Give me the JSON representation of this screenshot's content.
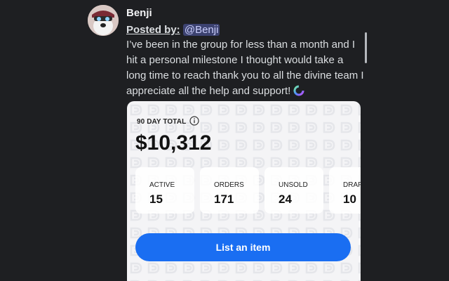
{
  "post": {
    "username": "Benji",
    "posted_by_label": "Posted by:",
    "mention": "@Benji",
    "message": "I’ve been in the group for less than a month and I hit a personal milestone I thought would take a long time to reach thank you to all the divine team I appreciate all the help and support!",
    "emoji": "spinning-gradient-ring-emoji"
  },
  "card": {
    "total_label": "90 DAY TOTAL",
    "total_value": "$10,312",
    "stats": [
      {
        "label": "ACTIVE",
        "value": "15"
      },
      {
        "label": "ORDERS",
        "value": "171"
      },
      {
        "label": "UNSOLD",
        "value": "24"
      },
      {
        "label": "DRAF",
        "value": "10"
      }
    ],
    "button_label": "List an item",
    "colors": {
      "button": "#1a6ef2",
      "card_bg": "#f4f4f6",
      "page_bg": "#1e1f22"
    }
  }
}
